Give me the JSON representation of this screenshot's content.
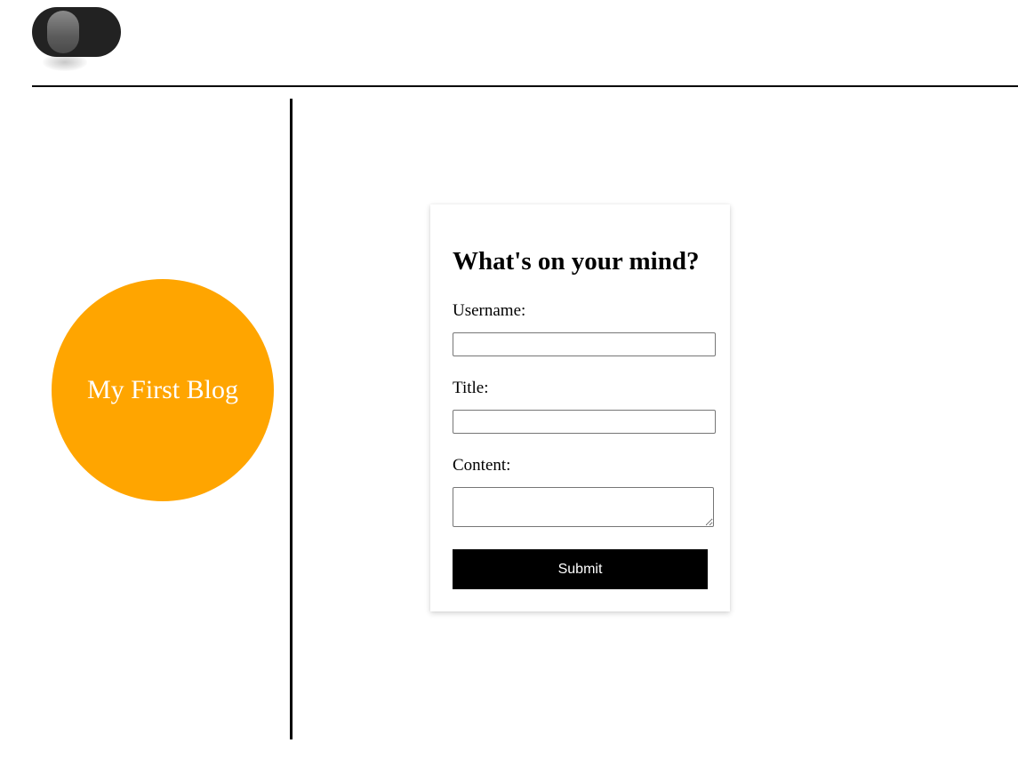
{
  "theme_toggle": {
    "state": "dark"
  },
  "sidebar": {
    "logo_text": "My First Blog",
    "logo_color": "#ffa500"
  },
  "form": {
    "title": "What's on your mind?",
    "username_label": "Username:",
    "username_value": "",
    "title_label": "Title:",
    "title_value": "",
    "content_label": "Content:",
    "content_value": "",
    "submit_label": "Submit"
  }
}
